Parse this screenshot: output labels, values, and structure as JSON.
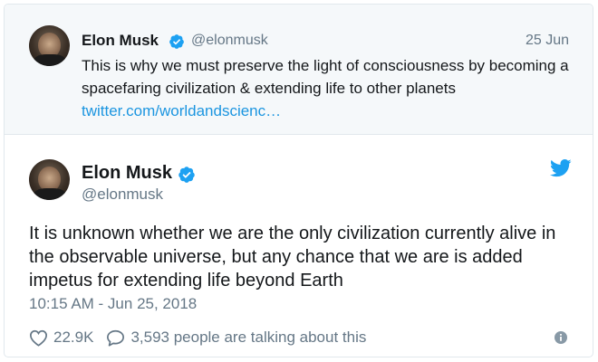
{
  "parent_tweet": {
    "author_name": "Elon Musk",
    "author_handle": "@elonmusk",
    "date": "25 Jun",
    "text": "This is why we must preserve the light of consciousness by becoming a spacefaring civilization & extending life to other planets",
    "link": "twitter.com/worldandscienc…"
  },
  "main_tweet": {
    "author_name": "Elon Musk",
    "author_handle": "@elonmusk",
    "text": "It is unknown whether we are the only civilization currently alive in the observable universe, but any chance that we are is added impetus for extending life beyond Earth",
    "timestamp": "10:15 AM - Jun 25, 2018",
    "likes": "22.9K",
    "conversation": "3,593 people are talking about this"
  },
  "icons": {
    "verified": "verified-badge-icon",
    "brand": "twitter-bird-icon",
    "like": "heart-icon",
    "reply": "speech-bubble-icon",
    "info": "info-icon"
  },
  "colors": {
    "accent": "#1da1f2",
    "link": "#1b95e0",
    "muted": "#657786",
    "parent_background": "#f5f8fa"
  }
}
